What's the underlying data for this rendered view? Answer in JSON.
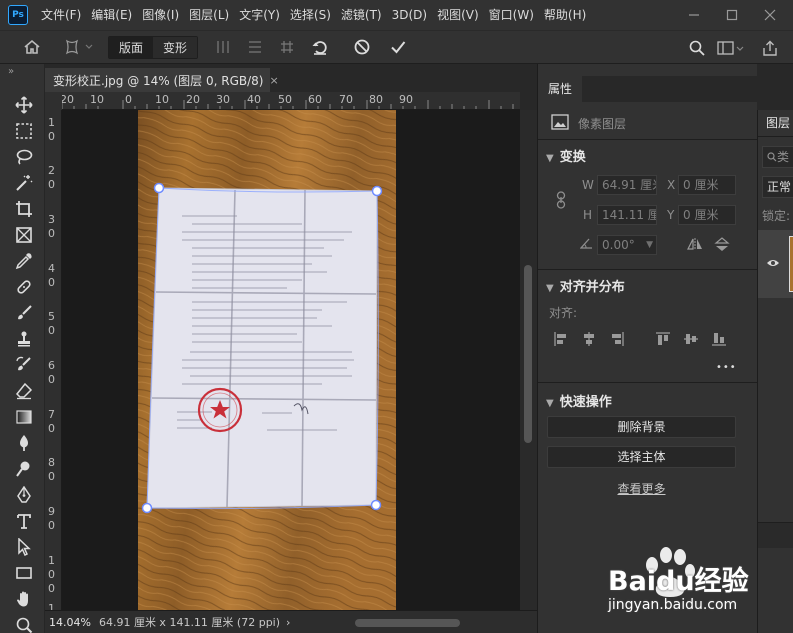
{
  "app": {
    "logo": "Ps",
    "accent": "#31a8ff"
  },
  "menu": [
    "文件(F)",
    "编辑(E)",
    "图像(I)",
    "图层(L)",
    "文字(Y)",
    "选择(S)",
    "滤镜(T)",
    "3D(D)",
    "视图(V)",
    "窗口(W)",
    "帮助(H)"
  ],
  "options": {
    "mode_layout": "版面",
    "mode_transform": "变形"
  },
  "document": {
    "tab_title": "变形校正.jpg @ 14% (图层 0, RGB/8)",
    "close_glyph": "×"
  },
  "rulers": {
    "top": [
      "20",
      "10",
      "0",
      "10",
      "20",
      "30",
      "40",
      "50",
      "60",
      "70",
      "80",
      "90"
    ],
    "left": [
      "1",
      "0",
      "2",
      "0",
      "3",
      "0",
      "4",
      "0",
      "5",
      "0",
      "6",
      "0",
      "7",
      "0",
      "8",
      "0",
      "9",
      "0",
      "1",
      "0",
      "0",
      "1",
      "0"
    ]
  },
  "status": {
    "zoom": "14.04%",
    "doc_size": "64.91 厘米 x 141.11 厘米 (72 ppi)",
    "arrow": "›"
  },
  "properties": {
    "tab": "属性",
    "layer_type": "像素图层",
    "transform_title": "变换",
    "w_label": "W",
    "w_value": "64.91 厘米",
    "x_label": "X",
    "x_value": "0 厘米",
    "h_label": "H",
    "h_value": "141.11 厘米",
    "y_label": "Y",
    "y_value": "0 厘米",
    "angle_value": "0.00°",
    "align_title": "对齐并分布",
    "align_label": "对齐:",
    "more": "•••",
    "quick_title": "快速操作",
    "btn_remove_bg": "删除背景",
    "btn_select_subject": "选择主体",
    "see_more": "查看更多"
  },
  "layers": {
    "tab": "图层",
    "search": "类",
    "blend": "正常",
    "lock": "锁定:"
  },
  "watermark": {
    "brand": "Baidu经验",
    "url": "jingyan.baidu.com"
  }
}
